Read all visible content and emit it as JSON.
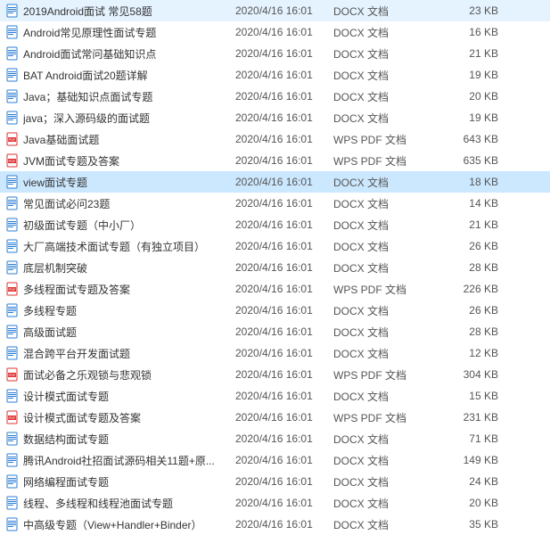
{
  "files": [
    {
      "name": "2019Android面试 常见58题",
      "date": "2020/4/16 16:01",
      "type": "DOCX 文档",
      "size": "23 KB",
      "icon": "docx",
      "selected": false
    },
    {
      "name": "Android常见原理性面试专题",
      "date": "2020/4/16 16:01",
      "type": "DOCX 文档",
      "size": "16 KB",
      "icon": "docx",
      "selected": false
    },
    {
      "name": "Android面试常问基础知识点",
      "date": "2020/4/16 16:01",
      "type": "DOCX 文档",
      "size": "21 KB",
      "icon": "docx",
      "selected": false
    },
    {
      "name": "BAT Android面试20题详解",
      "date": "2020/4/16 16:01",
      "type": "DOCX 文档",
      "size": "19 KB",
      "icon": "docx",
      "selected": false
    },
    {
      "name": "Java；基础知识点面试专题",
      "date": "2020/4/16 16:01",
      "type": "DOCX 文档",
      "size": "20 KB",
      "icon": "docx",
      "selected": false
    },
    {
      "name": "java；深入源码级的面试题",
      "date": "2020/4/16 16:01",
      "type": "DOCX 文档",
      "size": "19 KB",
      "icon": "docx",
      "selected": false
    },
    {
      "name": "Java基础面试题",
      "date": "2020/4/16 16:01",
      "type": "WPS PDF 文档",
      "size": "643 KB",
      "icon": "pdf",
      "selected": false
    },
    {
      "name": "JVM面试专题及答案",
      "date": "2020/4/16 16:01",
      "type": "WPS PDF 文档",
      "size": "635 KB",
      "icon": "pdf",
      "selected": false
    },
    {
      "name": "view面试专题",
      "date": "2020/4/16 16:01",
      "type": "DOCX 文档",
      "size": "18 KB",
      "icon": "docx",
      "selected": true
    },
    {
      "name": "常见面试必问23题",
      "date": "2020/4/16 16:01",
      "type": "DOCX 文档",
      "size": "14 KB",
      "icon": "docx",
      "selected": false
    },
    {
      "name": "初级面试专题（中小厂）",
      "date": "2020/4/16 16:01",
      "type": "DOCX 文档",
      "size": "21 KB",
      "icon": "docx",
      "selected": false
    },
    {
      "name": "大厂高端技术面试专题（有独立项目）",
      "date": "2020/4/16 16:01",
      "type": "DOCX 文档",
      "size": "26 KB",
      "icon": "docx",
      "selected": false
    },
    {
      "name": "底层机制突破",
      "date": "2020/4/16 16:01",
      "type": "DOCX 文档",
      "size": "28 KB",
      "icon": "docx",
      "selected": false
    },
    {
      "name": "多线程面试专题及答案",
      "date": "2020/4/16 16:01",
      "type": "WPS PDF 文档",
      "size": "226 KB",
      "icon": "pdf",
      "selected": false
    },
    {
      "name": "多线程专题",
      "date": "2020/4/16 16:01",
      "type": "DOCX 文档",
      "size": "26 KB",
      "icon": "docx",
      "selected": false
    },
    {
      "name": "高级面试题",
      "date": "2020/4/16 16:01",
      "type": "DOCX 文档",
      "size": "28 KB",
      "icon": "docx",
      "selected": false
    },
    {
      "name": "混合跨平台开发面试题",
      "date": "2020/4/16 16:01",
      "type": "DOCX 文档",
      "size": "12 KB",
      "icon": "docx",
      "selected": false
    },
    {
      "name": "面试必备之乐观锁与悲观锁",
      "date": "2020/4/16 16:01",
      "type": "WPS PDF 文档",
      "size": "304 KB",
      "icon": "pdf",
      "selected": false
    },
    {
      "name": "设计模式面试专题",
      "date": "2020/4/16 16:01",
      "type": "DOCX 文档",
      "size": "15 KB",
      "icon": "docx",
      "selected": false
    },
    {
      "name": "设计模式面试专题及答案",
      "date": "2020/4/16 16:01",
      "type": "WPS PDF 文档",
      "size": "231 KB",
      "icon": "pdf",
      "selected": false
    },
    {
      "name": "数据结构面试专题",
      "date": "2020/4/16 16:01",
      "type": "DOCX 文档",
      "size": "71 KB",
      "icon": "docx",
      "selected": false
    },
    {
      "name": "腾讯Android社招面试源码相关11题+原...",
      "date": "2020/4/16 16:01",
      "type": "DOCX 文档",
      "size": "149 KB",
      "icon": "docx",
      "selected": false
    },
    {
      "name": "网络编程面试专题",
      "date": "2020/4/16 16:01",
      "type": "DOCX 文档",
      "size": "24 KB",
      "icon": "docx",
      "selected": false
    },
    {
      "name": "线程、多线程和线程池面试专题",
      "date": "2020/4/16 16:01",
      "type": "DOCX 文档",
      "size": "20 KB",
      "icon": "docx",
      "selected": false
    },
    {
      "name": "中高级专题（View+Handler+Binder）",
      "date": "2020/4/16 16:01",
      "type": "DOCX 文档",
      "size": "35 KB",
      "icon": "docx",
      "selected": false
    }
  ]
}
